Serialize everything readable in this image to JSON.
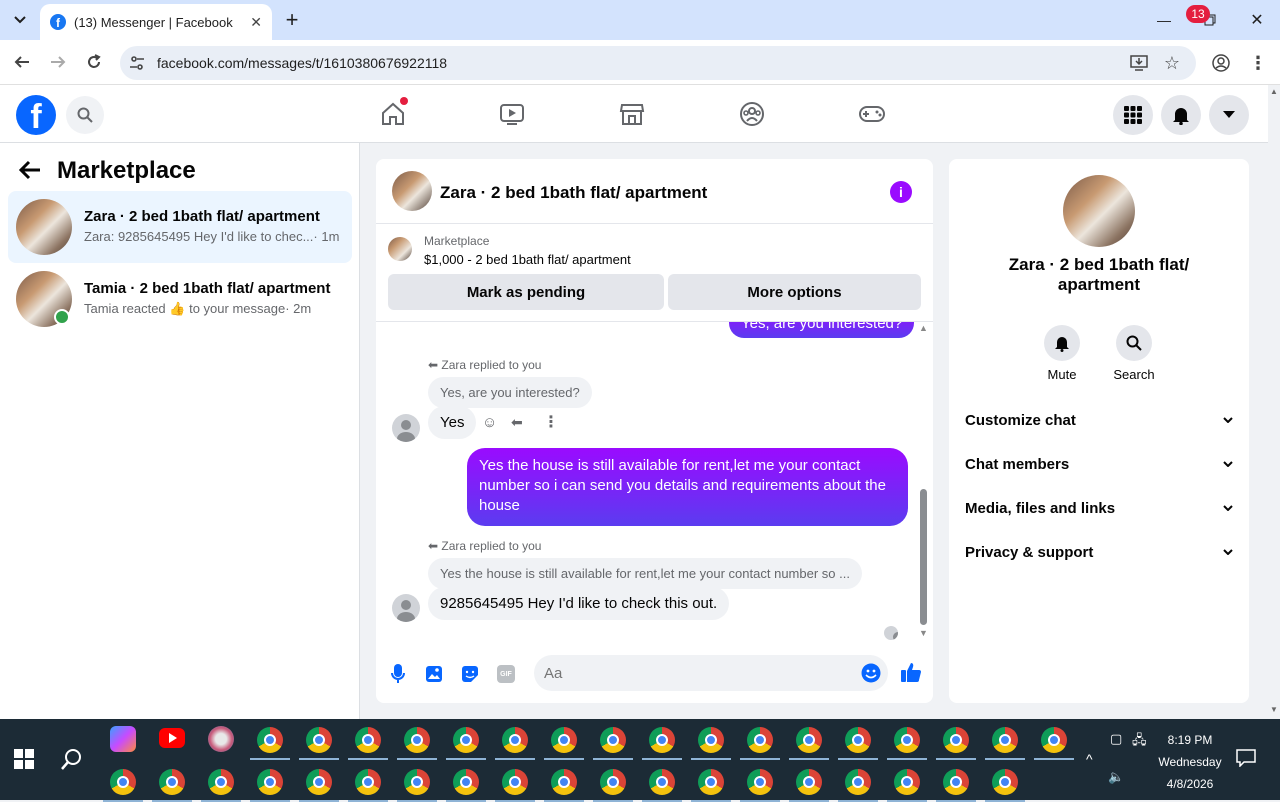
{
  "browser": {
    "tab_title": "(13) Messenger | Facebook",
    "url": "facebook.com/messages/t/1610380676922118"
  },
  "header": {
    "notification_count": "13"
  },
  "sidebar": {
    "title": "Marketplace",
    "conversations": [
      {
        "name": "Zara · 2 bed 1bath flat/ apartment",
        "preview": "Zara: 9285645495 Hey I'd like to chec...",
        "time": "· 1m",
        "active": true
      },
      {
        "name": "Tamia · 2 bed 1bath flat/ apartment",
        "preview_pre": "Tamia reacted",
        "preview_post": "to your message",
        "time": "· 2m",
        "active": false
      }
    ]
  },
  "chat": {
    "title": "Zara · 2 bed 1bath flat/ apartment",
    "listing_label": "Marketplace",
    "listing_item": "$1,000 - 2 bed 1bath flat/ apartment",
    "btn_pending": "Mark as pending",
    "btn_more": "More options",
    "messages": {
      "out_top": "Yes, are you interested?",
      "reply1_header": "Zara replied to you",
      "reply1_quote": "Yes, are you interested?",
      "reply1_text": "Yes",
      "out_main": "Yes the house is still available for rent,let me your contact number so i can send you details and requirements about the house",
      "reply2_header": "Zara replied to you",
      "reply2_quote": "Yes the house is still available for rent,let me your contact number so ...",
      "reply2_text": "9285645495 Hey I'd like to check this out."
    },
    "input_placeholder": "Aa"
  },
  "right_panel": {
    "name": "Zara · 2 bed 1bath flat/ apartment",
    "mute_label": "Mute",
    "search_label": "Search",
    "sections": [
      "Customize chat",
      "Chat members",
      "Media, files and links",
      "Privacy & support"
    ]
  },
  "taskbar": {
    "time": "8:19 PM",
    "day": "Wednesday",
    "date": "4/8/2026"
  },
  "colors": {
    "fb_blue": "#0866ff",
    "messenger_purple": "#9a0bff",
    "taskbar": "#1c2b36"
  }
}
